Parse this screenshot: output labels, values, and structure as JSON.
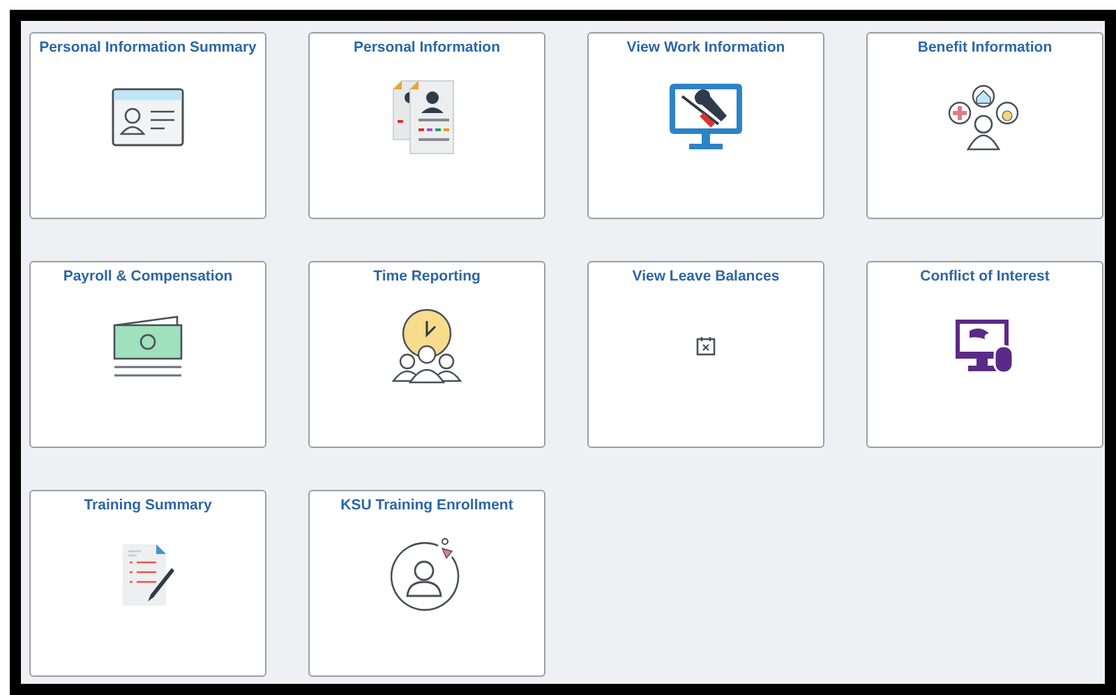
{
  "tiles": [
    {
      "title": "Personal Information Summary",
      "kind": "id-card"
    },
    {
      "title": "Personal Information",
      "kind": "documents"
    },
    {
      "title": "View Work Information",
      "kind": "monitor-tools"
    },
    {
      "title": "Benefit Information",
      "kind": "benefits"
    },
    {
      "title": "Payroll & Compensation",
      "kind": "money"
    },
    {
      "title": "Time Reporting",
      "kind": "clock-people"
    },
    {
      "title": "View Leave Balances",
      "kind": "calendar"
    },
    {
      "title": "Conflict of Interest",
      "kind": "monitor-mouse"
    },
    {
      "title": "Training Summary",
      "kind": "checklist-pen"
    },
    {
      "title": "KSU Training Enrollment",
      "kind": "person-cycle"
    }
  ]
}
